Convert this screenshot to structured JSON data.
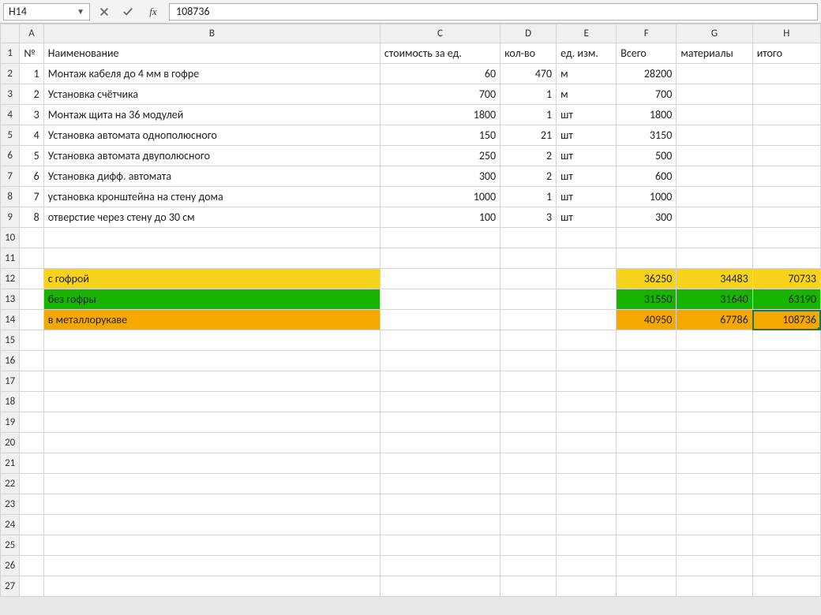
{
  "formula_bar": {
    "cell_ref": "H14",
    "cancel_title": "Cancel",
    "confirm_title": "Enter",
    "fx_label": "fx",
    "value": "108736"
  },
  "columns": [
    "A",
    "B",
    "C",
    "D",
    "E",
    "F",
    "G",
    "H"
  ],
  "selected_cell": "H14",
  "headers": {
    "A": "№",
    "B": "Наименование",
    "C": "стоимость за ед.",
    "D": "кол-во",
    "E": "ед. изм.",
    "F": "Всего",
    "G": "материалы",
    "H": "итого"
  },
  "items": [
    {
      "n": "1",
      "name": "Монтаж кабеля до 4 мм в гофре",
      "price": "60",
      "qty": "470",
      "unit": "м",
      "total": "28200"
    },
    {
      "n": "2",
      "name": "Установка счётчика",
      "price": "700",
      "qty": "1",
      "unit": "м",
      "total": "700"
    },
    {
      "n": "3",
      "name": "Монтаж щита на 36 модулей",
      "price": "1800",
      "qty": "1",
      "unit": "шт",
      "total": "1800"
    },
    {
      "n": "4",
      "name": "Установка автомата однополюсного",
      "price": "150",
      "qty": "21",
      "unit": "шт",
      "total": "3150"
    },
    {
      "n": "5",
      "name": "Установка автомата двуполюсного",
      "price": "250",
      "qty": "2",
      "unit": "шт",
      "total": "500"
    },
    {
      "n": "6",
      "name": "Установка дифф. автомата",
      "price": "300",
      "qty": "2",
      "unit": "шт",
      "total": "600"
    },
    {
      "n": "7",
      "name": "установка кронштейна на стену дома",
      "price": "1000",
      "qty": "1",
      "unit": "шт",
      "total": "1000"
    },
    {
      "n": "8",
      "name": "отверстие через стену до 30 см",
      "price": "100",
      "qty": "3",
      "unit": "шт",
      "total": "300"
    }
  ],
  "summary": [
    {
      "label": "с гофрой",
      "fill": "yellow",
      "F": "36250",
      "G": "34483",
      "H": "70733"
    },
    {
      "label": "без гофры",
      "fill": "green",
      "F": "31550",
      "G": "31640",
      "H": "63190"
    },
    {
      "label": "в металлорукаве",
      "fill": "orange",
      "F": "40950",
      "G": "67786",
      "H": "108736"
    }
  ],
  "row_count_visible": 27
}
